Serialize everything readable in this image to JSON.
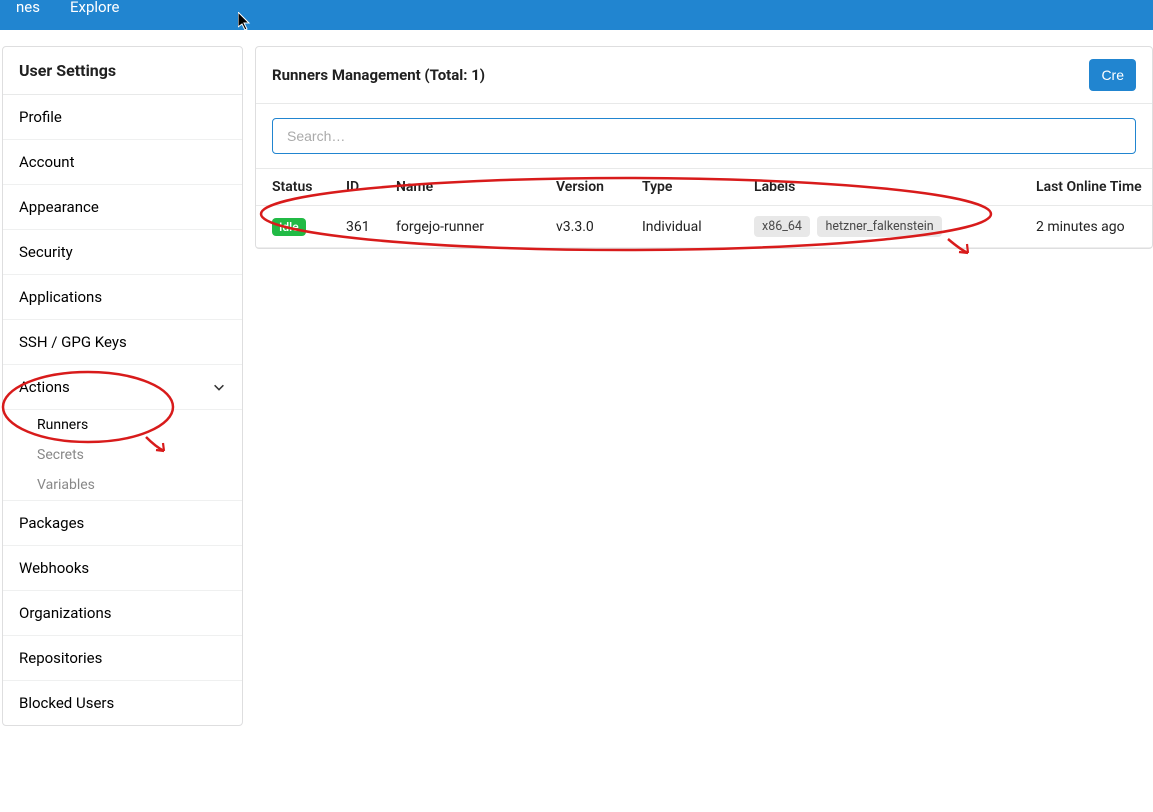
{
  "topnav": {
    "item1": "nes",
    "item2": "Explore"
  },
  "sidebar": {
    "header": "User Settings",
    "items": {
      "profile": "Profile",
      "account": "Account",
      "appearance": "Appearance",
      "security": "Security",
      "applications": "Applications",
      "sshgpg": "SSH / GPG Keys",
      "actions": "Actions",
      "actions_sub": {
        "runners": "Runners",
        "secrets": "Secrets",
        "variables": "Variables"
      },
      "packages": "Packages",
      "webhooks": "Webhooks",
      "organizations": "Organizations",
      "repositories": "Repositories",
      "blocked": "Blocked Users"
    }
  },
  "main": {
    "title": "Runners Management (Total: 1)",
    "create_button": "Cre",
    "search_placeholder": "Search…",
    "columns": {
      "status": "Status",
      "id": "ID",
      "name": "Name",
      "version": "Version",
      "type": "Type",
      "labels": "Labels",
      "last_online": "Last Online Time"
    },
    "rows": [
      {
        "status": "Idle",
        "id": "361",
        "name": "forgejo-runner",
        "version": "v3.3.0",
        "type": "Individual",
        "labels": [
          "x86_64",
          "hetzner_falkenstein"
        ],
        "last_online": "2 minutes ago"
      }
    ]
  }
}
